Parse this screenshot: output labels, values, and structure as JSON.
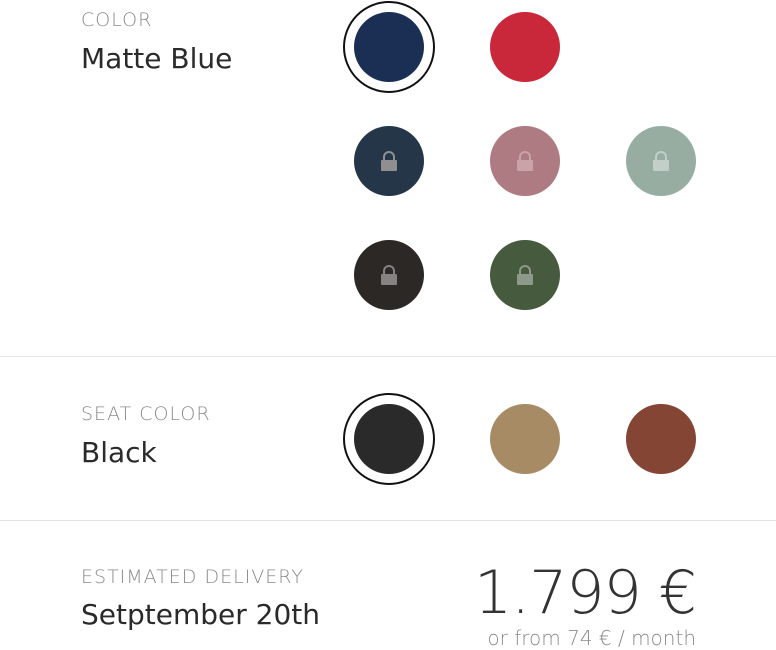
{
  "color_section": {
    "label": "COLOR",
    "value": "Matte Blue",
    "swatches": [
      {
        "name": "matte-blue",
        "hex": "#1b2f55",
        "selected": true,
        "locked": false
      },
      {
        "name": "red",
        "hex": "#c8283a",
        "selected": false,
        "locked": false
      },
      {
        "name": "dark-slate",
        "hex": "#263649",
        "selected": false,
        "locked": true
      },
      {
        "name": "dusty-rose",
        "hex": "#ad7b81",
        "selected": false,
        "locked": true
      },
      {
        "name": "sage",
        "hex": "#97ada2",
        "selected": false,
        "locked": true
      },
      {
        "name": "charcoal-brown",
        "hex": "#2c2825",
        "selected": false,
        "locked": true
      },
      {
        "name": "forest-green",
        "hex": "#465a3e",
        "selected": false,
        "locked": true
      }
    ]
  },
  "seat_section": {
    "label": "SEAT COLOR",
    "value": "Black",
    "swatches": [
      {
        "name": "black",
        "hex": "#292a29",
        "selected": true
      },
      {
        "name": "tan",
        "hex": "#a68b64",
        "selected": false
      },
      {
        "name": "cognac",
        "hex": "#844534",
        "selected": false
      }
    ]
  },
  "delivery_section": {
    "label": "ESTIMATED DELIVERY",
    "value": "Setptember 20th",
    "price": "1.799 €",
    "price_sub": "or from 74 € / month"
  },
  "colors": {
    "lock_icon": "#8f8f8f"
  }
}
